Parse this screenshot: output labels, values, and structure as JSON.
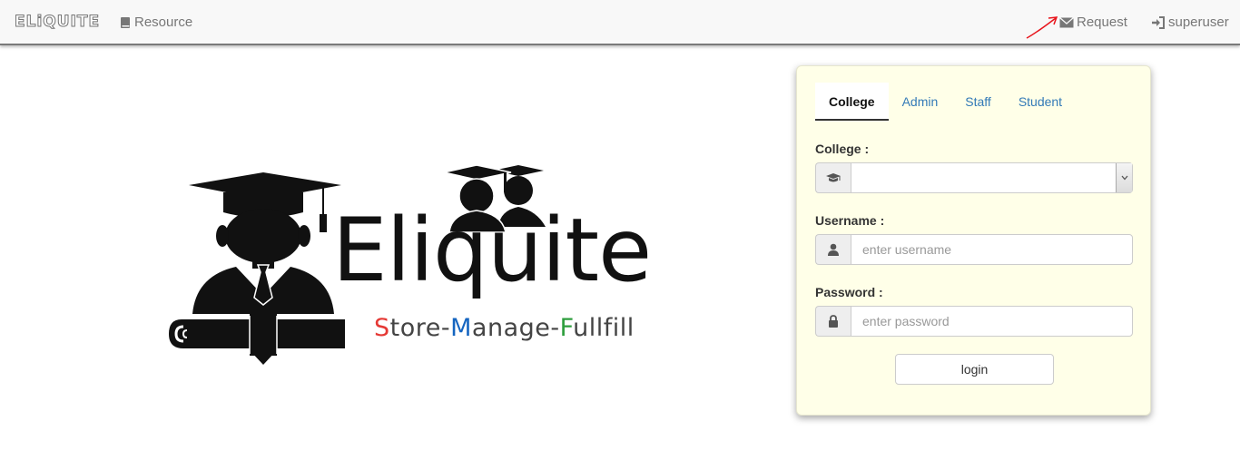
{
  "navbar": {
    "brand": "ELiQUITE",
    "resource_label": "Resource",
    "request_label": "Request",
    "user_label": "superuser",
    "annotation_color": "#e8141b"
  },
  "logo": {
    "title": "Eliquite",
    "tagline_s": "S",
    "tagline_tore": "tore-",
    "tagline_m": "M",
    "tagline_anage": "anage-",
    "tagline_f": "F",
    "tagline_ullfill": "ullfill"
  },
  "login": {
    "tabs": [
      {
        "label": "College",
        "active": true
      },
      {
        "label": "Admin",
        "active": false
      },
      {
        "label": "Staff",
        "active": false
      },
      {
        "label": "Student",
        "active": false
      }
    ],
    "college_label": "College :",
    "college_value": "",
    "username_label": "Username :",
    "username_placeholder": "enter username",
    "password_label": "Password :",
    "password_placeholder": "enter password",
    "login_button": "login"
  },
  "colors": {
    "navbar_bg": "#f8f8f8",
    "panel_bg": "#ffffe8",
    "link": "#337ab7",
    "tag_s": "#e53935",
    "tag_m": "#1565c0",
    "tag_f": "#2e9e3e"
  }
}
